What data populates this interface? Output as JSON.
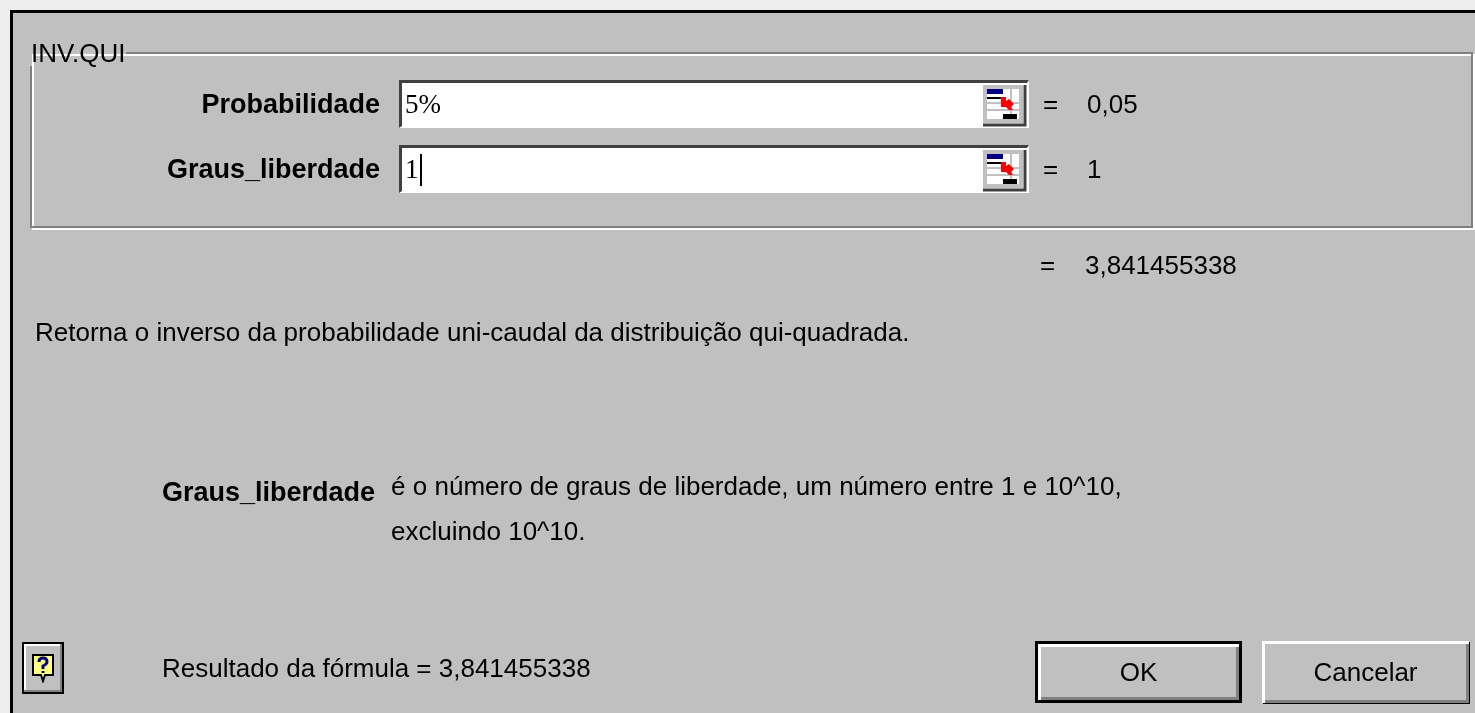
{
  "group_title": "INV.QUI",
  "arguments": [
    {
      "label": "Probabilidade",
      "value": "5%",
      "equals": "=",
      "result": "0,05",
      "focused": false
    },
    {
      "label": "Graus_liberdade",
      "value": "1",
      "equals": "=",
      "result": "1",
      "focused": true
    }
  ],
  "result": {
    "equals": "=",
    "value": "3,841455338"
  },
  "description": "Retorna o inverso da probabilidade uni-caudal da distribuição qui-quadrada.",
  "argument_help": {
    "label": "Graus_liberdade",
    "lines": [
      "é o número de graus de liberdade, um número entre 1 e 10^10,",
      "excluindo 10^10."
    ]
  },
  "formula_result": "Resultado da fórmula = 3,841455338",
  "buttons": [
    {
      "label": "OK",
      "default": true
    },
    {
      "label": "Cancelar",
      "default": false
    }
  ]
}
